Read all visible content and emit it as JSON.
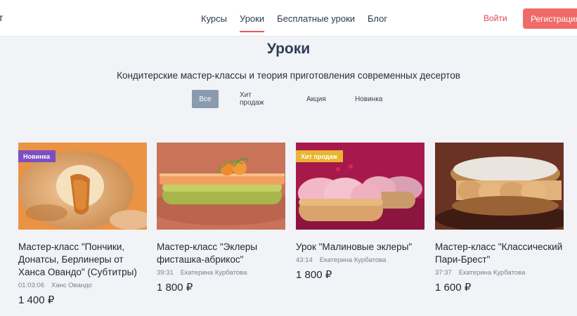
{
  "header": {
    "logo_fragment": "т",
    "nav": [
      {
        "label": "Курсы"
      },
      {
        "label": "Уроки",
        "active": true
      },
      {
        "label": "Бесплатные уроки"
      },
      {
        "label": "Блог"
      }
    ],
    "login_label": "Войти",
    "register_label": "Регистрация"
  },
  "main": {
    "title": "Уроки",
    "subtitle": "Кондитерские мастер-классы и теория приготовления современных десертов",
    "filters": [
      {
        "label": "Все",
        "active": true
      },
      {
        "label": "Хит продаж"
      },
      {
        "label": "Акция"
      },
      {
        "label": "Новинка"
      }
    ],
    "cards": [
      {
        "badge": "Новинка",
        "title": "Мастер-класс \"Пончики, Донатсы, Берлинеры от Ханса Овандо\" (Субтитры)",
        "duration": "01:03:06",
        "author": "Ханс Овандо",
        "price": "1 400 ₽"
      },
      {
        "badge": "",
        "title": "Мастер-класс \"Эклеры фисташка-абрикос\"",
        "duration": "39:31",
        "author": "Екатерина Курбатова",
        "price": "1 800 ₽"
      },
      {
        "badge": "Хит продаж",
        "title": "Урок \"Малиновые эклеры\"",
        "duration": "43:14",
        "author": "Екатерина Курбатова",
        "price": "1 800 ₽"
      },
      {
        "badge": "",
        "title": "Мастер-класс \"Классический Пари-Брест\"",
        "duration": "37:37",
        "author": "Екатерина Курбатова",
        "price": "1 600 ₽"
      }
    ]
  },
  "colors": {
    "accent": "#e8575b",
    "button": "#f06a6a",
    "badge_new": "#7b4fc4",
    "badge_hit": "#e9b52f",
    "filter_active": "#8a9bb0"
  }
}
